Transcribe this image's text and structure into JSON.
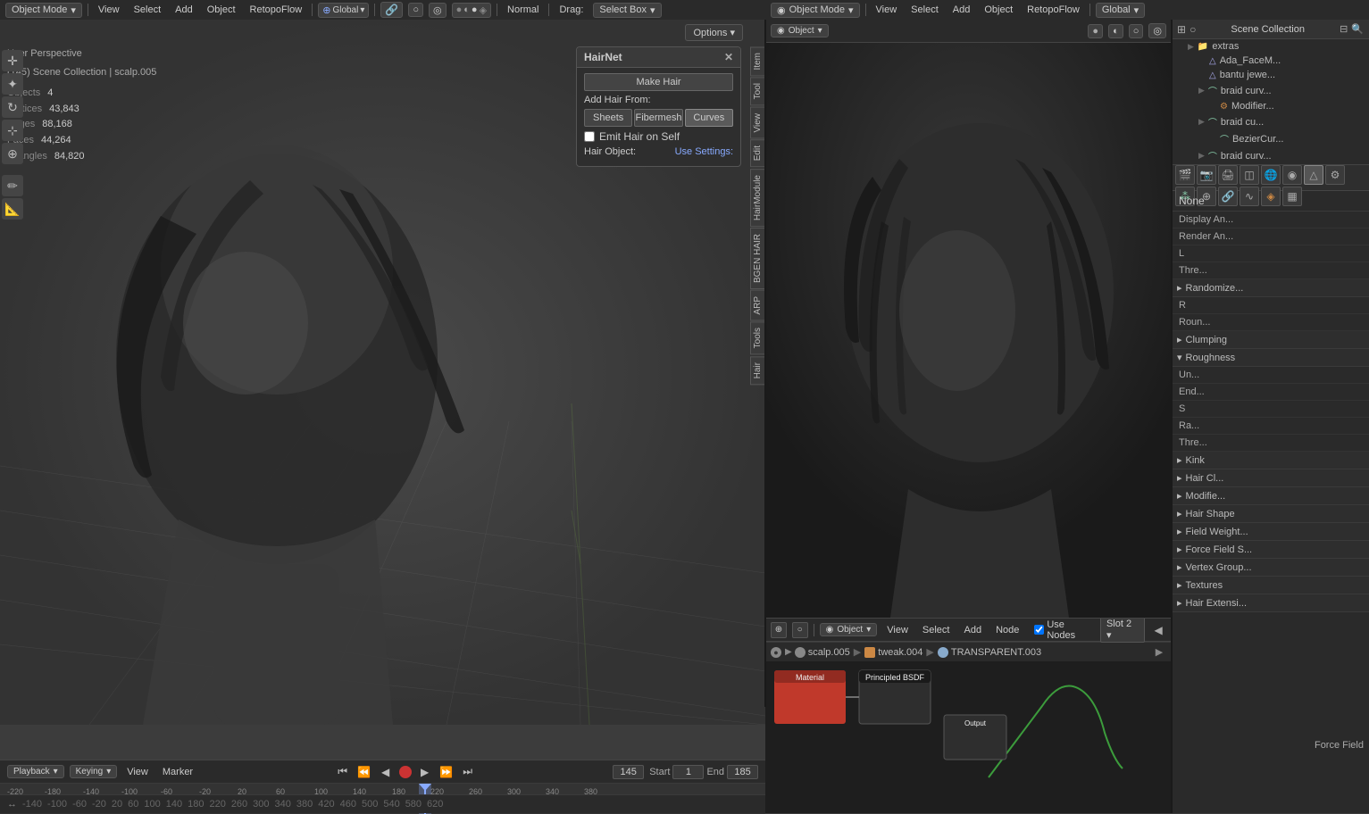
{
  "topbar_left": {
    "mode": "Object Mode",
    "view": "View",
    "select": "Select",
    "add": "Add",
    "object": "Object",
    "retopo_flow": "RetopoFlow",
    "transform": "Global",
    "normal": "Normal",
    "drag_label": "Drag:",
    "select_box": "Select Box",
    "drag_chevron": "▾"
  },
  "topbar_right": {
    "mode": "Object Mode",
    "view": "View",
    "select": "Select",
    "add": "Add",
    "object": "Object",
    "retopo_flow": "RetopoFlow",
    "global": "Global"
  },
  "left_viewport": {
    "perspective_label": "User Perspective",
    "scene_label": "(145) Scene Collection | scalp.005",
    "stats": {
      "objects": "Objects",
      "objects_val": "4",
      "vertices": "Vertices",
      "vertices_val": "43,843",
      "edges": "Edges",
      "edges_val": "88,168",
      "faces": "Faces",
      "faces_val": "44,264",
      "triangles": "Triangles",
      "triangles_val": "84,820"
    },
    "options_btn": "Options"
  },
  "hairnet_panel": {
    "title": "HairNet",
    "make_hair": "Make Hair",
    "add_hair_from": "Add Hair From:",
    "btn_sheets": "Sheets",
    "btn_fibermesh": "Fibermesh",
    "btn_curves": "Curves",
    "emit_label": "Emit Hair on Self",
    "hair_object": "Hair Object:",
    "use_settings": "Use Settings:"
  },
  "vtabs": {
    "item": "Item",
    "tool": "Tool",
    "view": "View",
    "edit": "Edit",
    "hair_module": "HairModule",
    "bgen_hair": "BGEN HAIR",
    "arp": "ARP",
    "tools": "Tools",
    "hair": "Hair"
  },
  "right_viewport": {
    "mode": "Object",
    "view": "View",
    "select": "Select",
    "add": "Add",
    "node": "Node",
    "use_nodes": "Use Nodes",
    "slot": "Slot 2"
  },
  "breadcrumb": {
    "scalp": "scalp.005",
    "tweak": "tweak.004",
    "transparent": "TRANSPARENT.003"
  },
  "node_editor": {
    "object": "Object",
    "view": "View",
    "select": "Select",
    "add": "Add",
    "node": "Node",
    "use_nodes": "Use Nodes",
    "slot": "Slot 2"
  },
  "properties_panel": {
    "scene_collection": "Scene Collection",
    "items": [
      {
        "label": "extras",
        "indent": 1
      },
      {
        "label": "Ada_FaceM...",
        "indent": 2
      },
      {
        "label": "bantu jewe...",
        "indent": 2
      },
      {
        "label": "braid curv...",
        "indent": 2
      },
      {
        "label": "Modifier...",
        "indent": 3
      },
      {
        "label": "braid cu...",
        "indent": 2
      },
      {
        "label": "BezierCur...",
        "indent": 3
      },
      {
        "label": "braid curv...",
        "indent": 2
      }
    ],
    "none_label": "None",
    "display_ann": "Display An...",
    "render_ann": "Render An...",
    "l_label": "L",
    "thre_label": "Thre...",
    "randomize": "Randomize...",
    "r_label": "R",
    "round": "Roun...",
    "clumping": "Clumping",
    "roughness": "Roughness",
    "un_label": "Un...",
    "end_label": "End...",
    "s_label": "S",
    "ra_label": "Ra...",
    "thre2_label": "Thre...",
    "kink": "Kink",
    "hair_cl": "Hair Cl...",
    "modified": "Modifie...",
    "hair_shape": "Hair Shape",
    "field_weight": "Field Weight...",
    "force_field_s": "Force Field S...",
    "vertex_group": "Vertex Group...",
    "textures": "Textures",
    "hair_ext": "Hair Extensi...",
    "force_field": "Force Field"
  },
  "timeline": {
    "start": "Start",
    "start_val": "1",
    "end": "End",
    "end_val": "185",
    "frame": "145",
    "markers": [
      "-220",
      "-180",
      "-140",
      "-100",
      "-60",
      "-20",
      "20",
      "60",
      "100",
      "140",
      "180",
      "220",
      "260",
      "300",
      "340",
      "380",
      "420",
      "460",
      "500",
      "540",
      "580",
      "620"
    ]
  },
  "bottom_bar": {
    "playback": "Playback",
    "keying": "Keying",
    "view": "View",
    "marker": "Marker"
  },
  "icons": {
    "arrow_right": "▶",
    "arrow_down": "▾",
    "checkbox_on": "☑",
    "checkbox_off": "☐",
    "chevron_down": "▾",
    "dot": "●",
    "circle": "○",
    "mesh_icon": "△",
    "curve_icon": "⌒",
    "eye": "👁",
    "camera": "📷",
    "filter": "⊞",
    "close": "✕",
    "expand": "▾",
    "collapse": "▸",
    "refresh": "↻",
    "plus": "+",
    "minus": "−",
    "gear": "⚙",
    "pin": "📌",
    "frame_skip_back": "⏮",
    "frame_back": "⏪",
    "frame_prev": "◀",
    "play": "▶",
    "frame_next": "▶▶",
    "frame_fwd": "⏩",
    "frame_skip_fwd": "⏭"
  }
}
